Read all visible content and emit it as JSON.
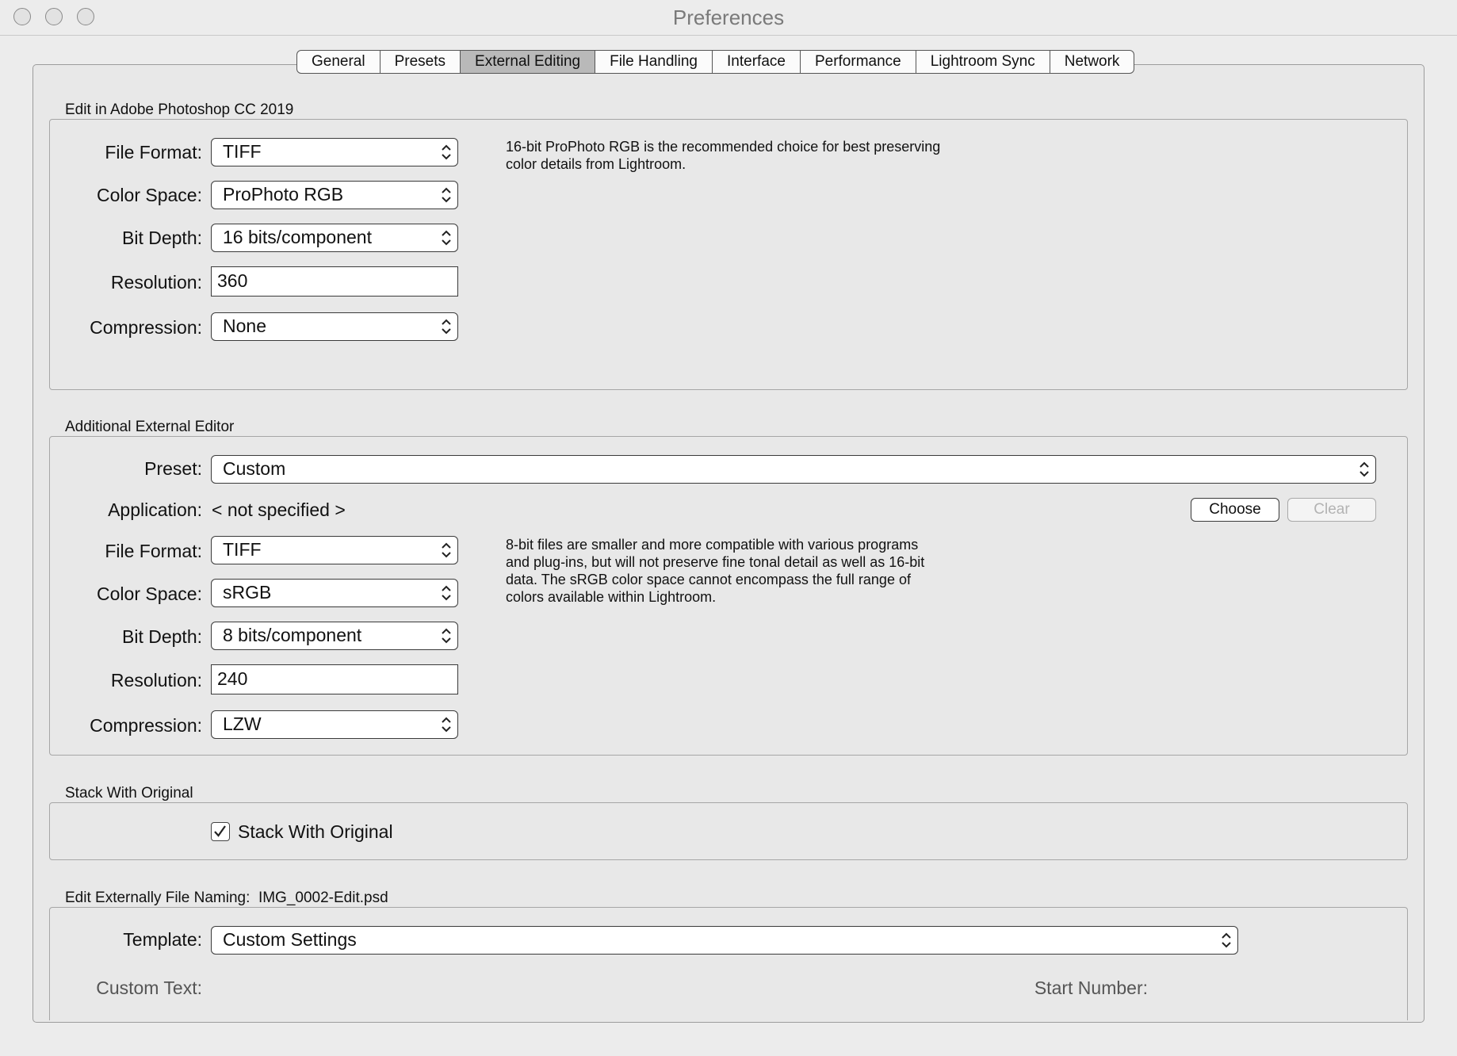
{
  "window": {
    "title": "Preferences"
  },
  "tabs": [
    {
      "label": "General"
    },
    {
      "label": "Presets"
    },
    {
      "label": "External Editing",
      "active": true
    },
    {
      "label": "File Handling"
    },
    {
      "label": "Interface"
    },
    {
      "label": "Performance"
    },
    {
      "label": "Lightroom Sync"
    },
    {
      "label": "Network"
    }
  ],
  "photoshop": {
    "title": "Edit in Adobe Photoshop CC 2019",
    "file_format_label": "File Format:",
    "file_format": "TIFF",
    "color_space_label": "Color Space:",
    "color_space": "ProPhoto RGB",
    "bit_depth_label": "Bit Depth:",
    "bit_depth": "16 bits/component",
    "resolution_label": "Resolution:",
    "resolution": "360",
    "compression_label": "Compression:",
    "compression": "None",
    "note_line1": "16-bit ProPhoto RGB is the recommended choice for best preserving",
    "note_line2": "color details from Lightroom."
  },
  "additional": {
    "title": "Additional External Editor",
    "preset_label": "Preset:",
    "preset": "Custom",
    "application_label": "Application:",
    "application": "< not specified >",
    "choose_label": "Choose",
    "clear_label": "Clear",
    "file_format_label": "File Format:",
    "file_format": "TIFF",
    "color_space_label": "Color Space:",
    "color_space": "sRGB",
    "bit_depth_label": "Bit Depth:",
    "bit_depth": "8 bits/component",
    "resolution_label": "Resolution:",
    "resolution": "240",
    "compression_label": "Compression:",
    "compression": "LZW",
    "note_line1": "8-bit files are smaller and more compatible with various programs",
    "note_line2": "and plug-ins, but will not preserve fine tonal detail as well as 16-bit",
    "note_line3": "data. The sRGB color space cannot encompass the full range of",
    "note_line4": "colors available within Lightroom."
  },
  "stack": {
    "title": "Stack With Original",
    "checkbox_label": "Stack With Original",
    "checked": true
  },
  "naming": {
    "title": "Edit Externally File Naming:",
    "example": "IMG_0002-Edit.psd",
    "template_label": "Template:",
    "template": "Custom Settings",
    "custom_text_label": "Custom Text:",
    "start_number_label": "Start Number:"
  }
}
